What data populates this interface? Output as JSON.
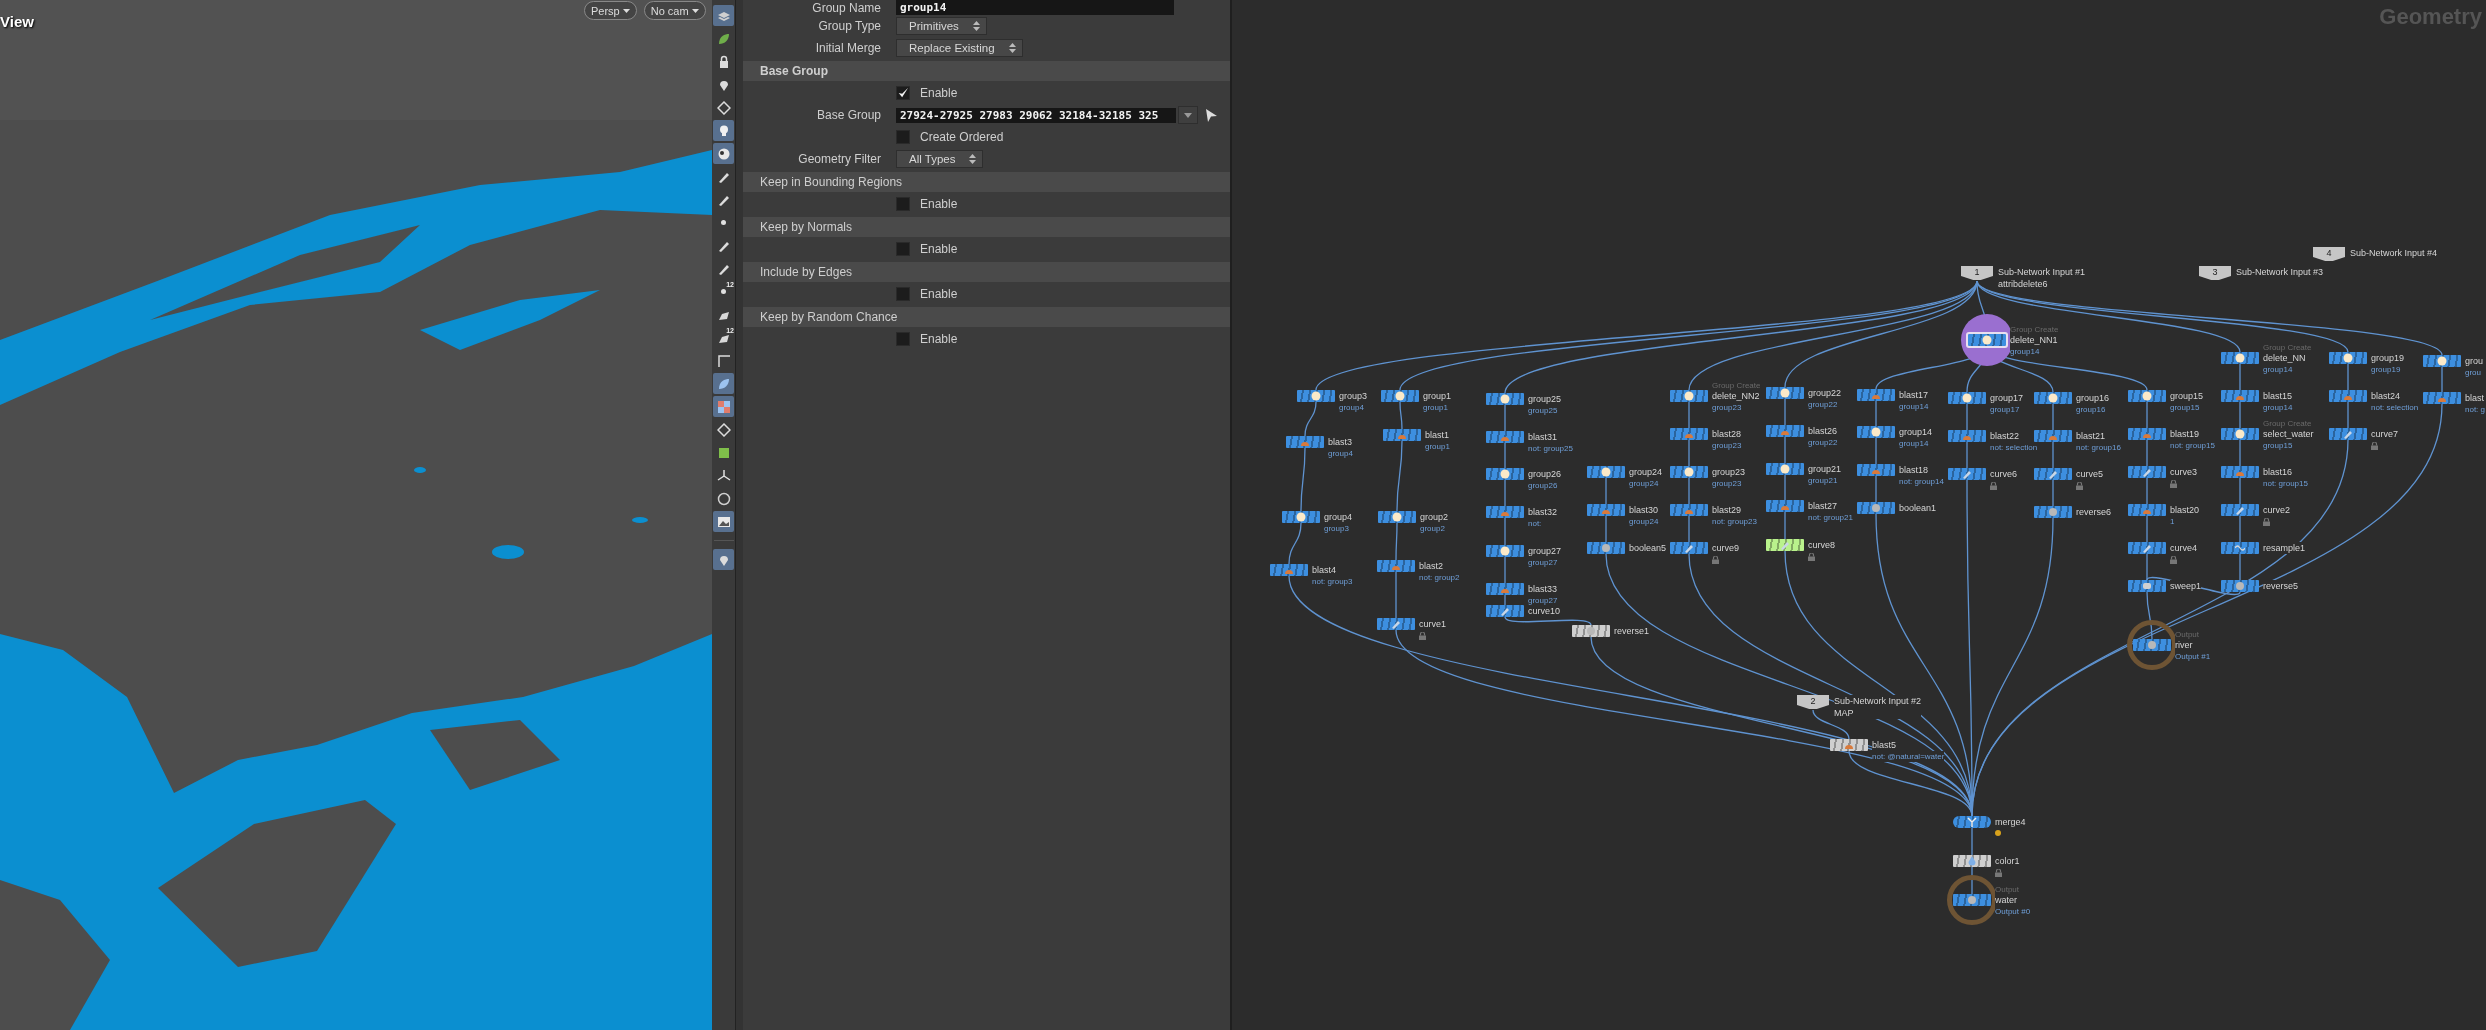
{
  "viewport": {
    "title": "View",
    "camera_menus": [
      "Persp",
      "No cam"
    ]
  },
  "viewport_toolbar": [
    {
      "on": true
    },
    {
      "on": false
    },
    {
      "on": false
    },
    {
      "on": false
    },
    {
      "on": false
    },
    {
      "on": true
    },
    {
      "on": true
    },
    {
      "on": false
    },
    {
      "on": false
    },
    {
      "on": false
    },
    {
      "on": false
    },
    {
      "on": false
    },
    {
      "on": false,
      "text": "12"
    },
    {
      "on": false
    },
    {
      "on": false,
      "text": "12"
    },
    {
      "on": false
    },
    {
      "on": true
    },
    {
      "on": true
    },
    {
      "on": false
    },
    {
      "on": false
    },
    {
      "on": false
    },
    {
      "on": false
    },
    {
      "on": true
    },
    {
      "on": true
    }
  ],
  "parameters": [
    {
      "kind": "field",
      "label": "Group Name",
      "value": "group14"
    },
    {
      "kind": "dropdown",
      "label": "Group Type",
      "value": "Primitives"
    },
    {
      "kind": "dropdown",
      "label": "Initial Merge",
      "value": "Replace Existing"
    },
    {
      "kind": "header",
      "label": "Base Group",
      "bold": true
    },
    {
      "kind": "checkbox",
      "label": "Enable",
      "checked": true
    },
    {
      "kind": "group-field",
      "label": "Base Group",
      "value": "27924-27925 27983 29062 32184-32185 325"
    },
    {
      "kind": "checkbox",
      "label": "Create Ordered",
      "checked": false
    },
    {
      "kind": "dropdown",
      "label": "Geometry Filter",
      "value": "All Types"
    },
    {
      "kind": "header",
      "label": "Keep in Bounding Regions",
      "bold": false
    },
    {
      "kind": "checkbox",
      "label": "Enable",
      "checked": false
    },
    {
      "kind": "header",
      "label": "Keep by Normals",
      "bold": false
    },
    {
      "kind": "checkbox",
      "label": "Enable",
      "checked": false
    },
    {
      "kind": "header",
      "label": "Include by Edges",
      "bold": false
    },
    {
      "kind": "checkbox",
      "label": "Enable",
      "checked": false
    },
    {
      "kind": "header",
      "label": "Keep by Random Chance",
      "bold": false
    },
    {
      "kind": "checkbox",
      "label": "Enable",
      "checked": false
    }
  ],
  "network": {
    "title": "Geometry",
    "inputs": [
      {
        "number": "1",
        "title": "Sub-Network Input #1",
        "label": "attribdelete6"
      },
      {
        "number": "3",
        "title": "Sub-Network Input #3"
      },
      {
        "number": "4",
        "title": "Sub-Network Input #4"
      },
      {
        "number": "2",
        "title": "Sub-Network Input #2",
        "label": "MAP"
      }
    ],
    "nodes": [
      {
        "name": "group3",
        "label": "group4",
        "kind": "group",
        "color": "#3d8fe0",
        "locked": false,
        "selected": false,
        "warning": false
      },
      {
        "name": "group1",
        "label": "group1",
        "kind": "group",
        "color": "#3d8fe0",
        "locked": false,
        "selected": false,
        "warning": false
      },
      {
        "name": "blast3",
        "label": "group4",
        "kind": "blast",
        "color": "#3d8fe0",
        "locked": false,
        "selected": false,
        "warning": false
      },
      {
        "name": "blast1",
        "label": "group1",
        "kind": "blast",
        "color": "#3d8fe0",
        "locked": false,
        "selected": false,
        "warning": false
      },
      {
        "name": "group4",
        "label": "group3",
        "kind": "group",
        "color": "#3d8fe0",
        "locked": false,
        "selected": false,
        "warning": false
      },
      {
        "name": "group2",
        "label": "group2",
        "kind": "group",
        "color": "#3d8fe0",
        "locked": false,
        "selected": false,
        "warning": false
      },
      {
        "name": "blast4",
        "label": "not: group3",
        "kind": "blast",
        "color": "#3d8fe0",
        "locked": false,
        "selected": false,
        "warning": false
      },
      {
        "name": "blast2",
        "label": "not: group2",
        "kind": "blast",
        "color": "#3d8fe0",
        "locked": false,
        "selected": false,
        "warning": false
      },
      {
        "name": "curve1",
        "kind": "curve",
        "color": "#3d8fe0",
        "locked": true,
        "selected": false,
        "warning": false
      },
      {
        "name": "group25",
        "label": "group25",
        "kind": "group",
        "color": "#3d8fe0",
        "locked": false,
        "selected": false,
        "warning": false
      },
      {
        "name": "blast31",
        "label": "not: group25",
        "kind": "blast",
        "color": "#3d8fe0",
        "locked": false,
        "selected": false,
        "warning": false
      },
      {
        "name": "group26",
        "label": "group26",
        "kind": "group",
        "color": "#3d8fe0",
        "locked": false,
        "selected": false,
        "warning": false
      },
      {
        "name": "blast32",
        "label": "not:",
        "kind": "blast",
        "color": "#3d8fe0",
        "locked": false,
        "selected": false,
        "warning": false
      },
      {
        "name": "group27",
        "label": "group27",
        "kind": "group",
        "color": "#3d8fe0",
        "locked": false,
        "selected": false,
        "warning": false
      },
      {
        "name": "blast33",
        "label": "group27",
        "kind": "blast",
        "color": "#3d8fe0",
        "locked": false,
        "selected": false,
        "warning": false
      },
      {
        "name": "curve10",
        "kind": "curve",
        "color": "#3d8fe0",
        "locked": false,
        "selected": false,
        "warning": false
      },
      {
        "name": "group24",
        "label": "group24",
        "kind": "group",
        "color": "#3d8fe0",
        "locked": false,
        "selected": false,
        "warning": false
      },
      {
        "name": "blast30",
        "label": "group24",
        "kind": "blast",
        "color": "#3d8fe0",
        "locked": false,
        "selected": false,
        "warning": false
      },
      {
        "name": "boolean5",
        "kind": "boolean",
        "color": "#3d8fe0",
        "locked": false,
        "selected": false,
        "warning": false
      },
      {
        "name": "reverse1",
        "kind": "reverse",
        "color": "#cfcfcf",
        "locked": false,
        "selected": false,
        "warning": false
      },
      {
        "name": "delete_NN2",
        "label": "group23",
        "type_label": "Group Create",
        "kind": "group",
        "color": "#3d8fe0",
        "locked": false,
        "selected": false,
        "warning": false
      },
      {
        "name": "blast28",
        "label": "group23",
        "kind": "blast",
        "color": "#3d8fe0",
        "locked": false,
        "selected": false,
        "warning": false
      },
      {
        "name": "group23",
        "label": "group23",
        "kind": "group",
        "color": "#3d8fe0",
        "locked": false,
        "selected": false,
        "warning": false
      },
      {
        "name": "blast29",
        "label": "not: group23",
        "kind": "blast",
        "color": "#3d8fe0",
        "locked": false,
        "selected": false,
        "warning": false
      },
      {
        "name": "curve9",
        "kind": "curve",
        "color": "#3d8fe0",
        "locked": true,
        "selected": false,
        "warning": false
      },
      {
        "name": "group22",
        "label": "group22",
        "kind": "group",
        "color": "#3d8fe0",
        "locked": false,
        "selected": false,
        "warning": false
      },
      {
        "name": "blast26",
        "label": "group22",
        "kind": "blast",
        "color": "#3d8fe0",
        "locked": false,
        "selected": false,
        "warning": false
      },
      {
        "name": "group21",
        "label": "group21",
        "kind": "group",
        "color": "#3d8fe0",
        "locked": false,
        "selected": false,
        "warning": false
      },
      {
        "name": "blast27",
        "label": "not: group21",
        "kind": "blast",
        "color": "#3d8fe0",
        "locked": false,
        "selected": false,
        "warning": false
      },
      {
        "name": "curve8",
        "kind": "curve",
        "color": "#b9f28c",
        "locked": true,
        "selected": false,
        "warning": false
      },
      {
        "name": "blast17",
        "label": "group14",
        "kind": "blast",
        "color": "#3d8fe0",
        "locked": false,
        "selected": false,
        "warning": false
      },
      {
        "name": "group14",
        "label": "group14",
        "kind": "group",
        "color": "#3d8fe0",
        "locked": false,
        "selected": false,
        "warning": false
      },
      {
        "name": "blast18",
        "label": "not: group14",
        "kind": "blast",
        "color": "#3d8fe0",
        "locked": false,
        "selected": false,
        "warning": false
      },
      {
        "name": "boolean1",
        "kind": "boolean",
        "color": "#3d8fe0",
        "locked": false,
        "selected": false,
        "warning": false
      },
      {
        "name": "delete_NN1",
        "label": "group14",
        "type_label": "Group Create",
        "kind": "group",
        "color": "#3d8fe0",
        "locked": false,
        "selected": true,
        "warning": false
      },
      {
        "name": "group17",
        "label": "group17",
        "kind": "group",
        "color": "#3d8fe0",
        "locked": false,
        "selected": false,
        "warning": false
      },
      {
        "name": "blast22",
        "label": "not: selection",
        "kind": "blast",
        "color": "#3d8fe0",
        "locked": false,
        "selected": false,
        "warning": false
      },
      {
        "name": "curve6",
        "kind": "curve",
        "color": "#3d8fe0",
        "locked": true,
        "selected": false,
        "warning": false
      },
      {
        "name": "group16",
        "label": "group16",
        "kind": "group",
        "color": "#3d8fe0",
        "locked": false,
        "selected": false,
        "warning": false
      },
      {
        "name": "blast21",
        "label": "not: group16",
        "kind": "blast",
        "color": "#3d8fe0",
        "locked": false,
        "selected": false,
        "warning": false
      },
      {
        "name": "curve5",
        "kind": "curve",
        "color": "#3d8fe0",
        "locked": true,
        "selected": false,
        "warning": false
      },
      {
        "name": "reverse6",
        "kind": "reverse",
        "color": "#3d8fe0",
        "locked": false,
        "selected": false,
        "warning": false
      },
      {
        "name": "group15",
        "label": "group15",
        "kind": "group",
        "color": "#3d8fe0",
        "locked": false,
        "selected": false,
        "warning": false
      },
      {
        "name": "blast19",
        "label": "not: group15",
        "kind": "blast",
        "color": "#3d8fe0",
        "locked": false,
        "selected": false,
        "warning": false
      },
      {
        "name": "curve3",
        "kind": "curve",
        "color": "#3d8fe0",
        "locked": true,
        "selected": false,
        "warning": false
      },
      {
        "name": "blast20",
        "label": "1",
        "kind": "blast",
        "color": "#3d8fe0",
        "locked": false,
        "selected": false,
        "warning": false
      },
      {
        "name": "curve4",
        "kind": "curve",
        "color": "#3d8fe0",
        "locked": true,
        "selected": false,
        "warning": false
      },
      {
        "name": "sweep1",
        "kind": "sweep",
        "color": "#3d8fe0",
        "locked": false,
        "selected": false,
        "warning": false
      },
      {
        "name": "river",
        "label": "Output #1",
        "type_label": "Output",
        "kind": "output",
        "color": "#3d8fe0",
        "locked": false,
        "selected": false,
        "warning": false
      },
      {
        "name": "delete_NN",
        "label": "group14",
        "type_label": "Group Create",
        "kind": "group",
        "color": "#3d8fe0",
        "locked": false,
        "selected": false,
        "warning": false
      },
      {
        "name": "blast15",
        "label": "group14",
        "kind": "blast",
        "color": "#3d8fe0",
        "locked": false,
        "selected": false,
        "warning": false
      },
      {
        "name": "select_water",
        "label": "group15",
        "type_label": "Group Create",
        "kind": "group",
        "color": "#3d8fe0",
        "locked": false,
        "selected": false,
        "warning": false
      },
      {
        "name": "blast16",
        "label": "not: group15",
        "kind": "blast",
        "color": "#3d8fe0",
        "locked": false,
        "selected": false,
        "warning": false
      },
      {
        "name": "curve2",
        "kind": "curve",
        "color": "#3d8fe0",
        "locked": true,
        "selected": false,
        "warning": false
      },
      {
        "name": "resample1",
        "kind": "resample",
        "color": "#3d8fe0",
        "locked": false,
        "selected": false,
        "warning": false
      },
      {
        "name": "reverse5",
        "kind": "reverse",
        "color": "#3d8fe0",
        "locked": false,
        "selected": false,
        "warning": false
      },
      {
        "name": "group19",
        "label": "group19",
        "kind": "group",
        "color": "#3d8fe0",
        "locked": false,
        "selected": false,
        "warning": false
      },
      {
        "name": "blast24",
        "label": "not: selection",
        "kind": "blast",
        "color": "#3d8fe0",
        "locked": false,
        "selected": false,
        "warning": false
      },
      {
        "name": "curve7",
        "kind": "curve",
        "color": "#3d8fe0",
        "locked": true,
        "selected": false,
        "warning": false
      },
      {
        "name": "grou",
        "label": "grou",
        "kind": "group",
        "color": "#3d8fe0",
        "locked": false,
        "selected": false,
        "warning": false
      },
      {
        "name": "blast",
        "label": "not: g",
        "kind": "blast",
        "color": "#3d8fe0",
        "locked": false,
        "selected": false,
        "warning": false
      },
      {
        "name": "blast5",
        "label": "not: @natural=water",
        "kind": "blast",
        "color": "#cfcfcf",
        "locked": false,
        "selected": false,
        "warning": false
      },
      {
        "name": "merge4",
        "kind": "merge",
        "color": "#3d8fe0",
        "locked": false,
        "selected": false,
        "warning": true
      },
      {
        "name": "color1",
        "kind": "color",
        "color": "#cfcfcf",
        "locked": true,
        "selected": false,
        "warning": false
      },
      {
        "name": "water",
        "label": "Output #0",
        "type_label": "Output",
        "kind": "output",
        "color": "#3d8fe0",
        "locked": false,
        "selected": false,
        "warning": false
      }
    ]
  }
}
